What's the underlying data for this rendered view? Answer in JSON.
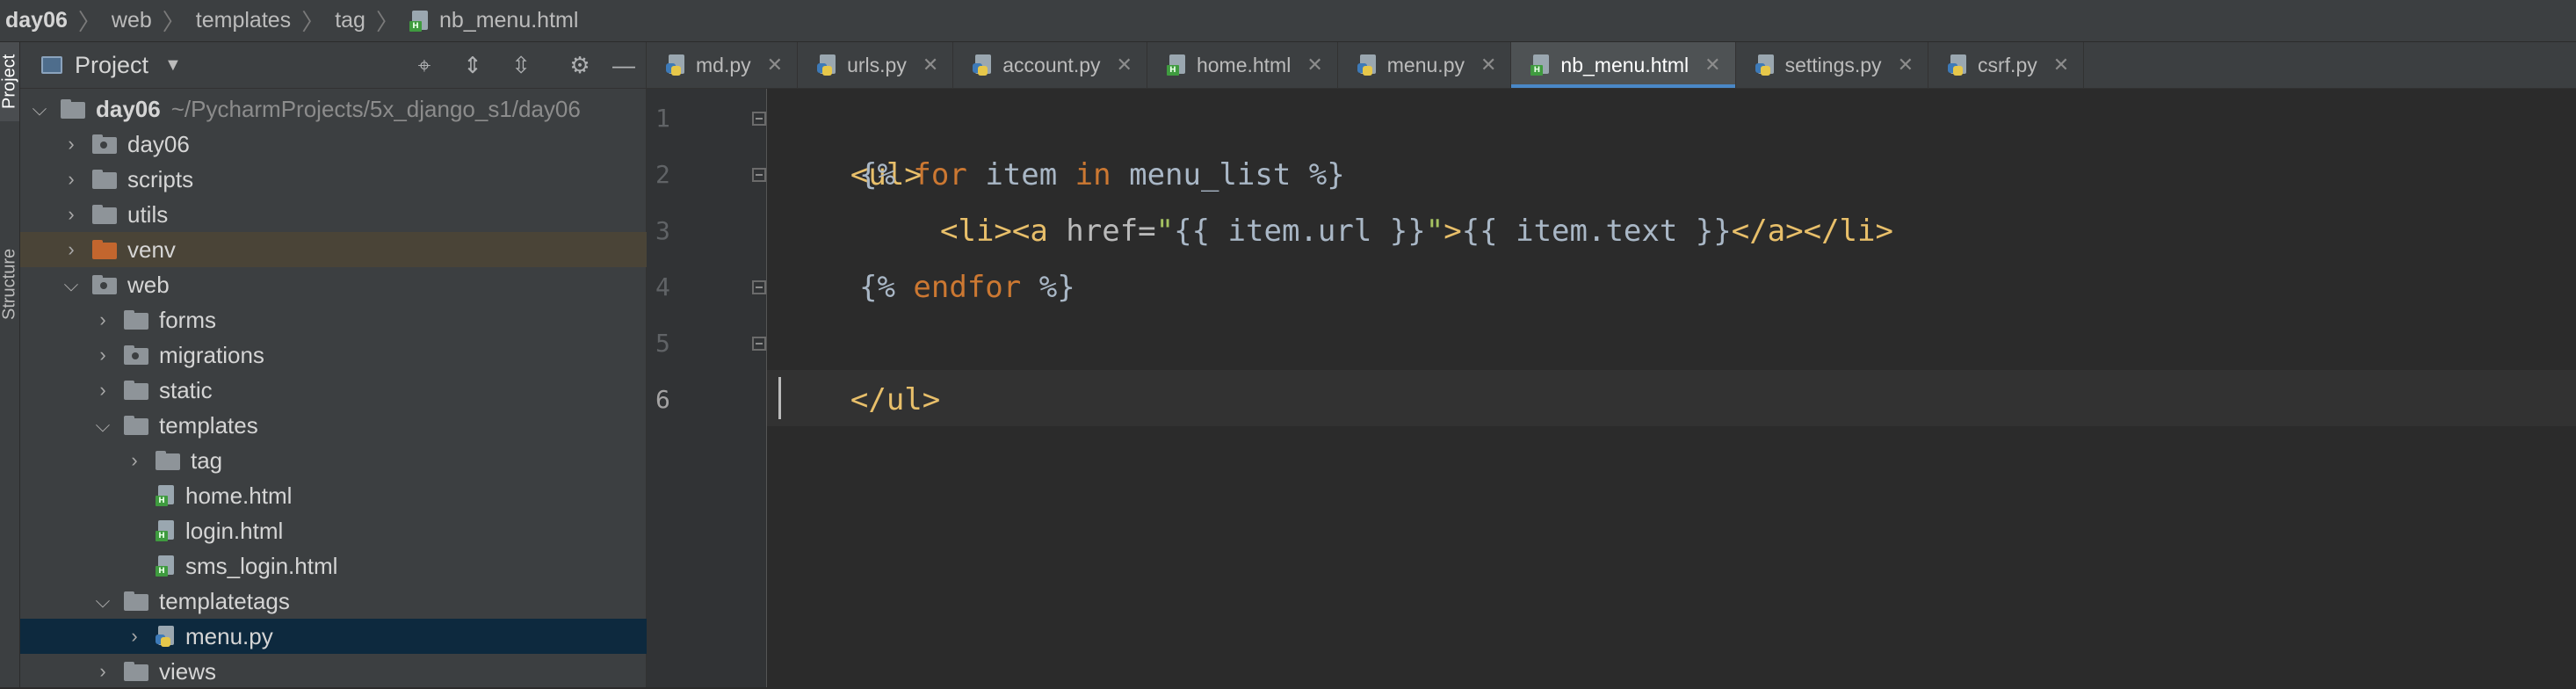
{
  "breadcrumb": [
    "day06",
    "web",
    "templates",
    "tag",
    "nb_menu.html"
  ],
  "tool_strip": {
    "project": "Project",
    "structure": "Structure"
  },
  "project_panel": {
    "title": "Project",
    "root": {
      "name": "day06",
      "path": "~/PycharmProjects/5x_django_s1/day06"
    },
    "items": [
      {
        "label": "day06"
      },
      {
        "label": "scripts"
      },
      {
        "label": "utils"
      },
      {
        "label": "venv"
      },
      {
        "label": "web"
      },
      {
        "label": "forms"
      },
      {
        "label": "migrations"
      },
      {
        "label": "static"
      },
      {
        "label": "templates"
      },
      {
        "label": "tag"
      },
      {
        "label": "home.html"
      },
      {
        "label": "login.html"
      },
      {
        "label": "sms_login.html"
      },
      {
        "label": "templatetags"
      },
      {
        "label": "menu.py"
      },
      {
        "label": "views"
      }
    ]
  },
  "editor": {
    "tabs": [
      {
        "label": "md.py",
        "type": "py"
      },
      {
        "label": "urls.py",
        "type": "py"
      },
      {
        "label": "account.py",
        "type": "py"
      },
      {
        "label": "home.html",
        "type": "html"
      },
      {
        "label": "menu.py",
        "type": "py"
      },
      {
        "label": "nb_menu.html",
        "type": "html",
        "active": true
      },
      {
        "label": "settings.py",
        "type": "py"
      },
      {
        "label": "csrf.py",
        "type": "py"
      }
    ],
    "line_numbers": [
      "1",
      "2",
      "3",
      "4",
      "5",
      "6"
    ],
    "code": {
      "l1": [
        "<ul>"
      ],
      "l2": [
        "{%",
        " for ",
        "item",
        " in ",
        "menu_list",
        " %}"
      ],
      "l3": [
        "<li><a ",
        "href=",
        "\"",
        "{{ item.url }}",
        "\"",
        ">",
        "{{ item.text }}",
        "</a></li>"
      ],
      "l4": [
        "{%",
        " endfor ",
        "%}"
      ],
      "l5": [
        "</ul>"
      ]
    }
  },
  "colors": {
    "background": "#2b2b2b",
    "panel": "#3c3f41",
    "selection": "#0d293e",
    "accent": "#4a88c7",
    "tag": "#e8bf6a",
    "keyword": "#cc7832",
    "string": "#a5c261"
  }
}
